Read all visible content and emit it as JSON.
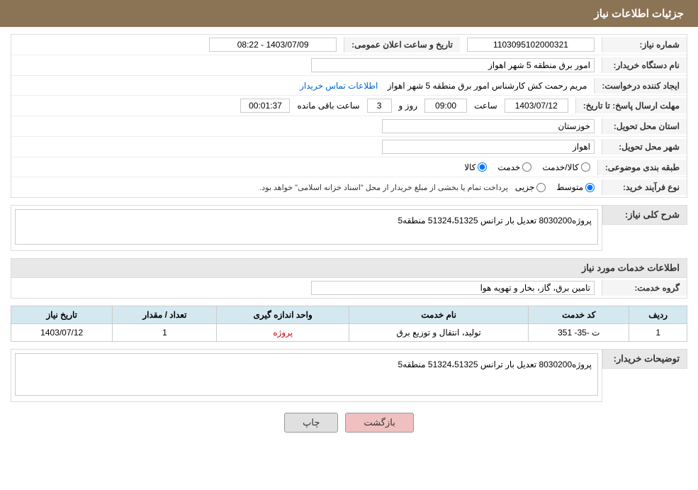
{
  "header": {
    "title": "جزئیات اطلاعات نیاز"
  },
  "fields": {
    "need_number_label": "شماره نیاز:",
    "need_number_value": "1103095102000321",
    "announce_date_label": "تاریخ و ساعت اعلان عمومی:",
    "announce_date_value": "1403/07/09 - 08:22",
    "buyer_station_label": "نام دستگاه خریدار:",
    "buyer_station_value": "امور برق منطقه 5 شهر اهواز",
    "requester_label": "ایجاد کننده درخواست:",
    "requester_value": "مریم رحمت کش کارشناس امور برق منطقه 5 شهر اهواز",
    "requester_link": "اطلاعات تماس خریدار",
    "response_deadline_label": "مهلت ارسال پاسخ: تا تاریخ:",
    "response_date_value": "1403/07/12",
    "response_time_label": "ساعت",
    "response_time_value": "09:00",
    "response_days_label": "روز و",
    "response_days_value": "3",
    "response_remaining_label": "ساعت باقی مانده",
    "response_remaining_value": "00:01:37",
    "delivery_province_label": "استان محل تحویل:",
    "delivery_province_value": "خوزستان",
    "delivery_city_label": "شهر محل تحویل:",
    "delivery_city_value": "اهواز",
    "category_label": "طبقه بندی موضوعی:",
    "category_options": [
      "کالا",
      "خدمت",
      "کالا/خدمت"
    ],
    "category_selected": "کالا",
    "purchase_type_label": "نوع فرآیند خرید:",
    "purchase_type_options": [
      "جزیی",
      "متوسط"
    ],
    "purchase_type_selected": "متوسط",
    "purchase_type_note": "پرداخت تمام یا بخشی از مبلغ خریدار از محل \"اسناد خزانه اسلامی\" خواهد بود.",
    "general_desc_label": "شرح کلی نیاز:",
    "general_desc_value": "پروژه8030200 تعدیل بار ترانس 51324،51325 منطقه5",
    "services_info_label": "اطلاعات خدمات مورد نیاز",
    "service_group_label": "گروه خدمت:",
    "service_group_value": "تامین برق، گاز، بخار و تهویه هوا",
    "table": {
      "headers": [
        "ردیف",
        "کد خدمت",
        "نام خدمت",
        "واحد اندازه گیری",
        "تعداد / مقدار",
        "تاریخ نیاز"
      ],
      "rows": [
        {
          "row": "1",
          "code": "ت -35- 351",
          "name": "تولید، انتقال و توزیع برق",
          "unit": "پروژه",
          "quantity": "1",
          "date": "1403/07/12"
        }
      ]
    },
    "buyer_desc_label": "توضیحات خریدار:",
    "buyer_desc_value": "پروژه8030200 تعدیل بار ترانس 51324،51325 منطقه5"
  },
  "buttons": {
    "print_label": "چاپ",
    "back_label": "بازگشت"
  }
}
